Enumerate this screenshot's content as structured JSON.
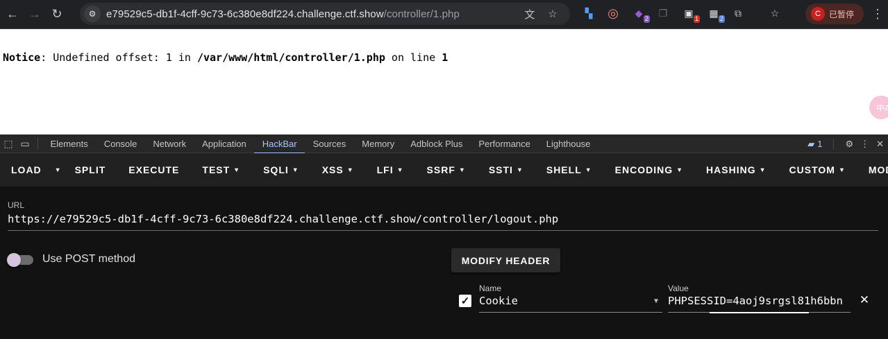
{
  "browser": {
    "url_host": "e79529c5-db1f-4cff-9c73-6c380e8df224.challenge.ctf.show",
    "url_path": "/controller/1.php",
    "profile_initial": "C",
    "profile_label": "已暂停",
    "extension_badges": [
      "2",
      "1",
      "2"
    ],
    "icons": {
      "back": "arrow-left-icon",
      "forward": "arrow-right-icon",
      "reload": "reload-icon",
      "site_info": "tune-icon",
      "translate": "translate-icon",
      "bookmark": "star-icon",
      "menu": "more-vert-icon"
    }
  },
  "page": {
    "notice_label": "Notice",
    "notice_text": ": Undefined offset: 1 in ",
    "notice_path": "/var/www/html/controller/1.php",
    "notice_on_line": " on line ",
    "notice_line": "1",
    "float_widget_text": "中A"
  },
  "devtools": {
    "tabs": [
      "Elements",
      "Console",
      "Network",
      "Application",
      "HackBar",
      "Sources",
      "Memory",
      "Adblock Plus",
      "Performance",
      "Lighthouse"
    ],
    "active_tab": "HackBar",
    "message_count": "1"
  },
  "hackbar": {
    "toolbar": [
      "LOAD",
      "SPLIT",
      "EXECUTE",
      "TEST",
      "SQLI",
      "XSS",
      "LFI",
      "SSRF",
      "SSTI",
      "SHELL",
      "ENCODING",
      "HASHING",
      "CUSTOM",
      "MODE"
    ],
    "url_label": "URL",
    "url_value": "https://e79529c5-db1f-4cff-9c73-6c380e8df224.challenge.ctf.show/controller/logout.php",
    "post_label": "Use POST method",
    "post_enabled": false,
    "modify_header_label": "MODIFY HEADER",
    "header": {
      "enabled": true,
      "name_label": "Name",
      "name_value": "Cookie",
      "value_label": "Value",
      "value_value": "PHPSESSID=4aoj9srgsl81h6bbn"
    },
    "colors": {
      "active_tab": "#a8c7fa",
      "background": "#121212",
      "toolbar": "#212121"
    }
  }
}
